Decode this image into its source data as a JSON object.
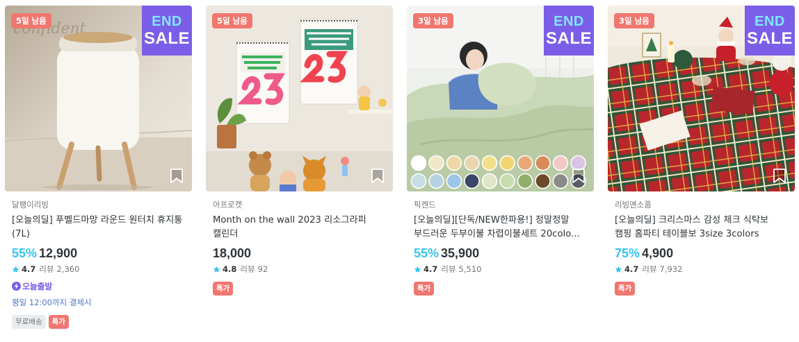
{
  "colors": {
    "accent_discount": "#35c5f0",
    "badge_red": "#f0776f",
    "end_sale_purple": "#7b5ee8",
    "delivery_blue": "#4a76c9"
  },
  "products": [
    {
      "days_left": "5일 남음",
      "end_sale": true,
      "end_sale_line1": "END",
      "end_sale_line2": "SALE",
      "brand": "달팽이리빙",
      "title": "[오늘의딜] 푸벨드마망 라운드 원터치 휴지통(7L)",
      "discount": "55%",
      "price": "12,900",
      "rating": "4.7",
      "reviews_label": "리뷰",
      "reviews_count": "2,360",
      "today_delivery": "오늘출발",
      "delivery_note": "평일 12:00까지 결제시",
      "tags": [
        {
          "label": "무료배송",
          "style": "gray"
        },
        {
          "label": "특가",
          "style": "red"
        }
      ]
    },
    {
      "days_left": "5일 남음",
      "end_sale": false,
      "brand": "아프로캣",
      "title": "Month on the wall 2023 리소그라피 캘린더",
      "discount": "",
      "price": "18,000",
      "rating": "4.8",
      "reviews_label": "리뷰",
      "reviews_count": "92",
      "tags": [
        {
          "label": "특가",
          "style": "red"
        }
      ]
    },
    {
      "days_left": "3일 남음",
      "end_sale": true,
      "end_sale_line1": "END",
      "end_sale_line2": "SALE",
      "brand": "픽켄드",
      "title": "[오늘의딜][단독/NEW한파용!] 정말정말 부드러운 두부이불 차렵이불세트 20colo...",
      "discount": "55%",
      "price": "35,900",
      "rating": "4.7",
      "reviews_label": "리뷰",
      "reviews_count": "5,510",
      "tags": [
        {
          "label": "특가",
          "style": "red"
        }
      ]
    },
    {
      "days_left": "3일 남음",
      "end_sale": true,
      "end_sale_line1": "END",
      "end_sale_line2": "SALE",
      "brand": "리빙앤소품",
      "title": "[오늘의딜] 크리스마스 감성 체크 식탁보 캠핑 홈파티 테이블보 3size 3colors",
      "discount": "75%",
      "price": "4,900",
      "rating": "4.7",
      "reviews_label": "리뷰",
      "reviews_count": "7,932",
      "tags": [
        {
          "label": "특가",
          "style": "red"
        }
      ]
    }
  ]
}
